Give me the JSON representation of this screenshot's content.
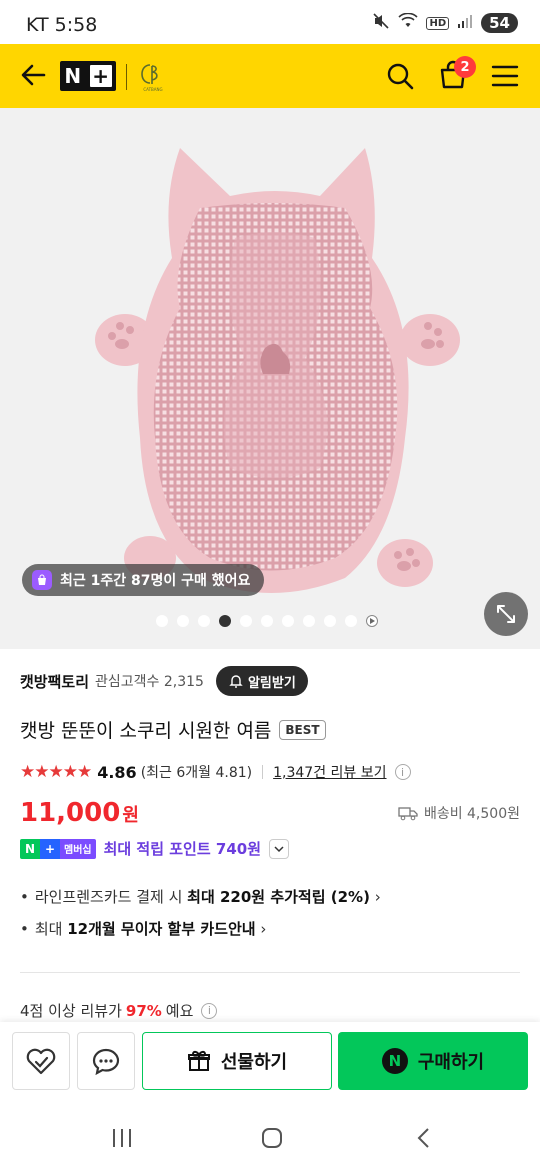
{
  "status": {
    "carrier": "KT 5:58",
    "hd": "HD",
    "battery": "54"
  },
  "header": {
    "cart_count": "2",
    "brand_small": "CATBANG"
  },
  "hero": {
    "recent_purchase": "최근 1주간 87명이 구매 했어요",
    "dot_count": 10,
    "active_dot": 3
  },
  "store": {
    "name": "캣방팩토리",
    "meta": "관심고객수 2,315",
    "alarm_label": "알림받기"
  },
  "product": {
    "title": "캣방 뚠뚠이 소쿠리 시원한 여름",
    "badge": "BEST",
    "stars": "★★★★★",
    "score": "4.86",
    "recent_score": "(최근 6개월 4.81)",
    "review_link": "1,347건 리뷰 보기",
    "price": "11,000",
    "won": "원",
    "shipping": "배송비 4,500원"
  },
  "points": {
    "n": "N",
    "plus": "+",
    "membership": "멤버십",
    "text": "최대 적립 포인트 740원"
  },
  "benefits": [
    {
      "prefix": "라인프렌즈카드 결제 시 ",
      "bold": "최대 220원 추가적립 (2%)",
      "suffix": " ›"
    },
    {
      "prefix": "최대 ",
      "bold": "12개월 무이자 할부 카드안내",
      "suffix": " ›"
    }
  ],
  "review_pct": {
    "prefix": "4점 이상 리뷰가 ",
    "pct": "97%",
    "suffix": " 예요"
  },
  "actions": {
    "gift": "선물하기",
    "buy": "구매하기",
    "n": "N"
  },
  "colors": {
    "header": "#ffd600",
    "price": "#f0272d",
    "buy": "#03c75a",
    "point": "#6b3dde"
  }
}
